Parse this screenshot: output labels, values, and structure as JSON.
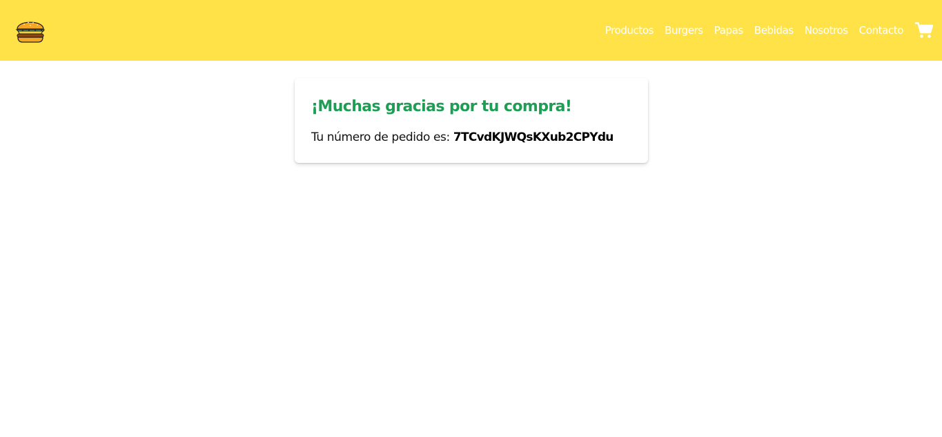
{
  "header": {
    "logo_icon": "burger-icon",
    "background_color": "#ffe247",
    "nav_items": [
      {
        "label": "Productos"
      },
      {
        "label": "Burgers"
      },
      {
        "label": "Papas"
      },
      {
        "label": "Bebidas"
      },
      {
        "label": "Nosotros"
      },
      {
        "label": "Contacto"
      }
    ],
    "cart_icon": "shopping-cart-icon"
  },
  "confirmation": {
    "title": "¡Muchas gracias por tu compra!",
    "order_text": "Tu número de pedido es:",
    "order_id": "7TCvdKJWQsKXub2CPYdu",
    "title_color": "#1f9d55"
  }
}
